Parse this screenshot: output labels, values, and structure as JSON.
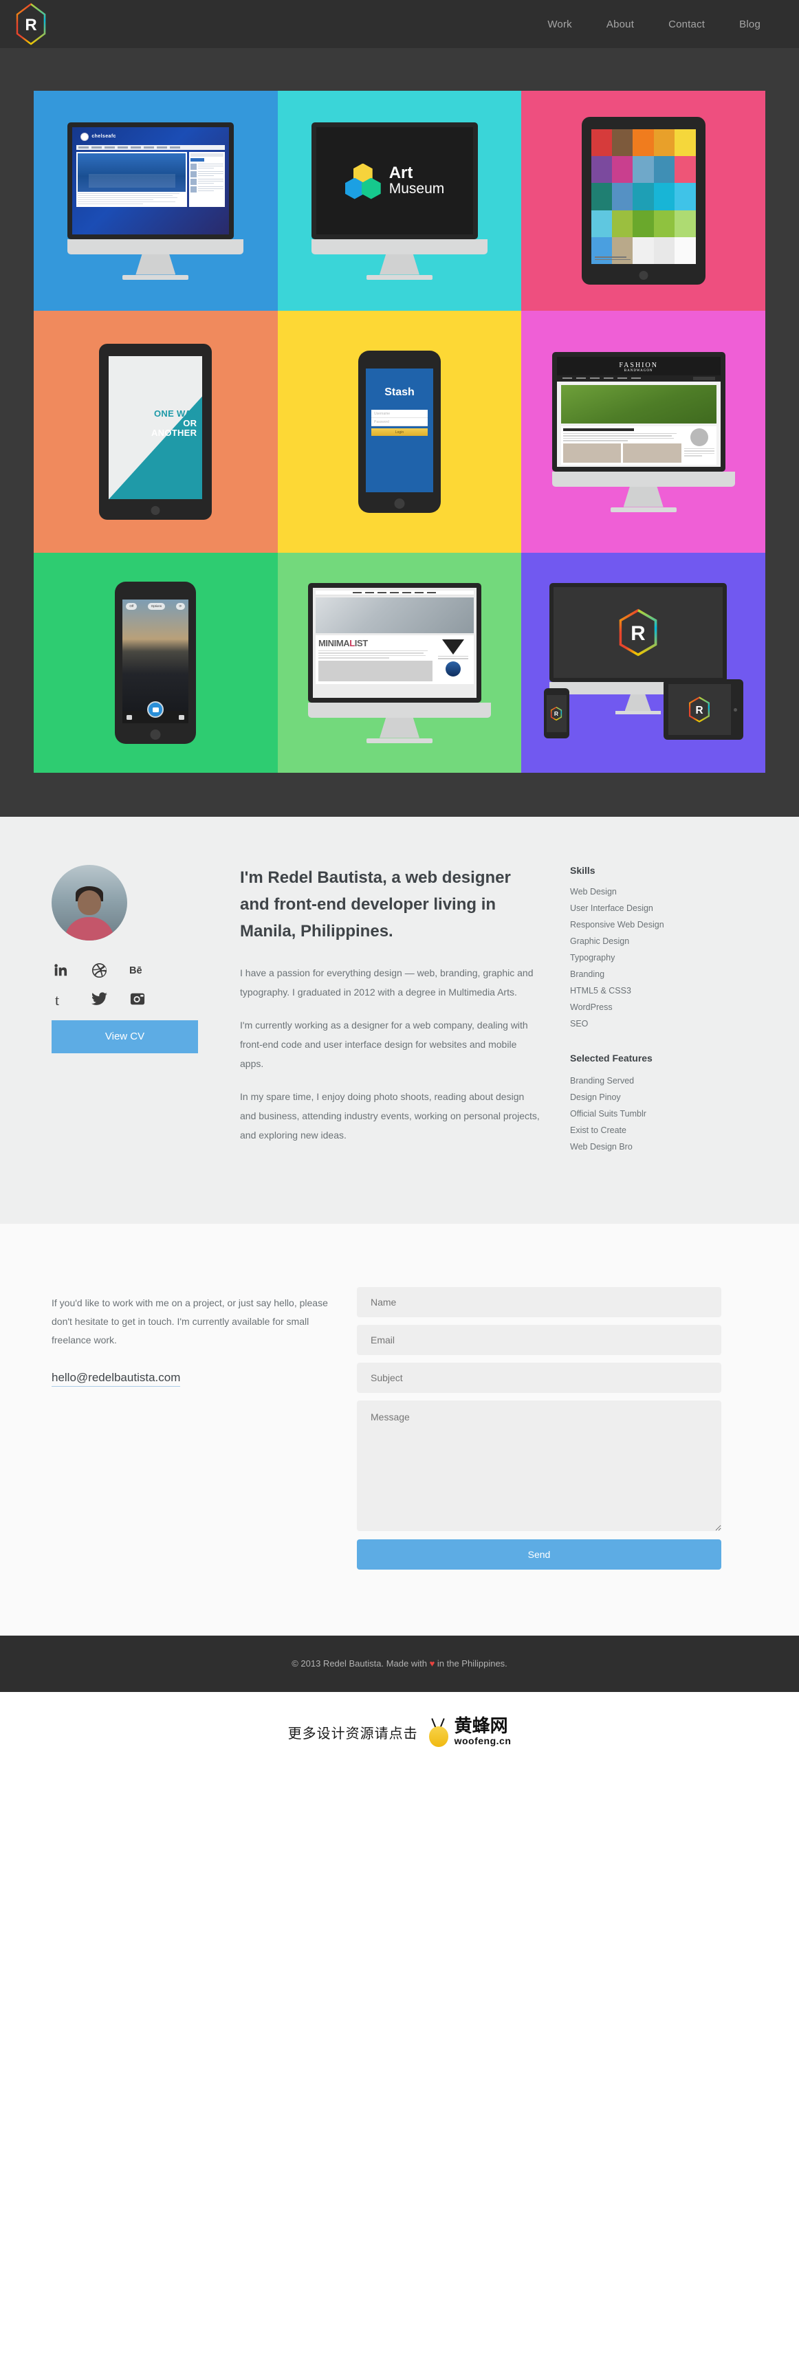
{
  "header": {
    "logo_letter": "R",
    "nav": [
      {
        "label": "Work"
      },
      {
        "label": "About"
      },
      {
        "label": "Contact"
      },
      {
        "label": "Blog"
      }
    ]
  },
  "work": {
    "tiles": [
      {
        "name": "chelsea-fc-website",
        "bg": "#3498db",
        "device": "imac",
        "caption": "chelseafc",
        "nav_items": 9
      },
      {
        "name": "art-museum-branding",
        "bg": "#3ad5d8",
        "device": "imac",
        "logo_line1": "Art",
        "logo_line2": "Museum",
        "hex_colors": [
          "#f6d33c",
          "#1ca0e3",
          "#16c98d"
        ]
      },
      {
        "name": "triangle-collage-poster",
        "bg": "#ee4f7f",
        "device": "tablet",
        "caption_lines": 2
      },
      {
        "name": "one-way-or-another-poster",
        "bg": "#f08a5d",
        "device": "tablet",
        "poster_line1": "ONE WAY",
        "poster_line2": "OR",
        "poster_line3": "ANOTHER",
        "accent": "#1f9aa8"
      },
      {
        "name": "stash-mobile-app",
        "bg": "#fdd835",
        "device": "phone",
        "app_title": "Stash",
        "username_placeholder": "Username",
        "password_placeholder": "Password",
        "login_label": "Login",
        "app_bg": "#1f63ab"
      },
      {
        "name": "fashion-bandwagon-blog",
        "bg": "#ef5fd6",
        "device": "imac",
        "site_title": "FASHION",
        "site_subtitle": "BANDWAGON",
        "post_title": "Roll up those sleeves"
      },
      {
        "name": "camera-app",
        "bg": "#2ecc71",
        "device": "phone",
        "flash_label": "Off",
        "options_label": "Options"
      },
      {
        "name": "minimalist-blog",
        "bg": "#73d97c",
        "device": "imac",
        "logo_part1": "MINIMA",
        "logo_part2": "L",
        "logo_part3": "IST"
      },
      {
        "name": "responsive-identity",
        "bg": "#7159f0",
        "device": "responsive-set",
        "logo_letter": "R"
      }
    ]
  },
  "about": {
    "heading": "I'm Redel Bautista, a web designer and front-end developer living in Manila, Philippines.",
    "paragraphs": [
      "I have a passion for everything design — web, branding, graphic and typography. I graduated in 2012 with a degree in Multimedia Arts.",
      "I'm currently working as a designer for a web company, dealing with front-end code and user interface design for websites and mobile apps.",
      "In my spare time, I enjoy doing photo shoots, reading about design and business, attending industry events, working on personal projects, and exploring new ideas."
    ],
    "social": [
      {
        "name": "linkedin",
        "label": "LinkedIn"
      },
      {
        "name": "dribbble",
        "label": "Dribbble"
      },
      {
        "name": "behance",
        "label": "Behance"
      },
      {
        "name": "tumblr",
        "label": "Tumblr"
      },
      {
        "name": "twitter",
        "label": "Twitter"
      },
      {
        "name": "instagram",
        "label": "Instagram"
      }
    ],
    "cv_button": "View CV",
    "skills_title": "Skills",
    "skills": [
      "Web Design",
      "User Interface Design",
      "Responsive Web Design",
      "Graphic Design",
      "Typography",
      "Branding",
      "HTML5 & CSS3",
      "WordPress",
      "SEO"
    ],
    "features_title": "Selected Features",
    "features": [
      "Branding Served",
      "Design Pinoy",
      "Official Suits Tumblr",
      "Exist to Create",
      "Web Design Bro"
    ]
  },
  "contact": {
    "copy": "If you'd like to work with me on a project, or just say hello, please don't hesitate to get in touch. I'm currently available for small freelance work.",
    "email": "hello@redelbautista.com",
    "form": {
      "name_placeholder": "Name",
      "email_placeholder": "Email",
      "subject_placeholder": "Subject",
      "message_placeholder": "Message",
      "send_label": "Send"
    }
  },
  "footer": {
    "copyright_before": "© 2013 Redel Bautista. Made with ",
    "heart": "♥",
    "copyright_after": " in the Philippines."
  },
  "promo": {
    "text": "更多设计资源请点击",
    "brand_cn": "黄蜂网",
    "brand_url": "woofeng.cn"
  },
  "colors": {
    "accent": "#5dace4",
    "dark": "#2f2f2f",
    "work_bg": "#3a3a3a",
    "about_bg": "#eeefef",
    "contact_bg": "#fafafa"
  }
}
